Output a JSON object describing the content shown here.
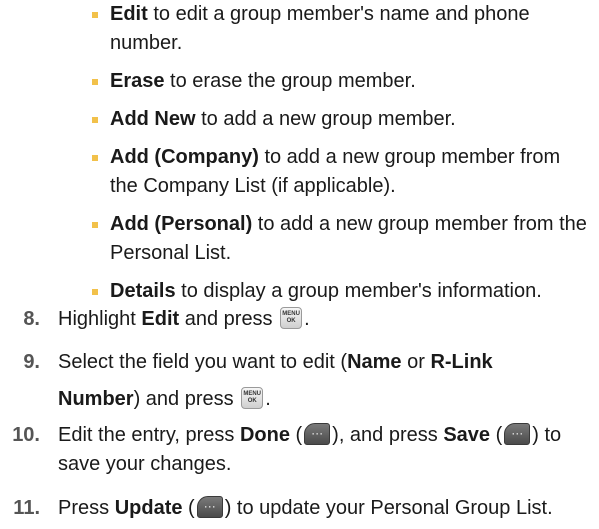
{
  "options": [
    {
      "term": "Edit",
      "text": " to edit a group member's name and phone number."
    },
    {
      "term": "Erase",
      "text": " to erase the group member."
    },
    {
      "term": "Add New",
      "text": " to add a new group member."
    },
    {
      "term": "Add (Company)",
      "text": " to add a new group member from the Company List (if applicable)."
    },
    {
      "term": "Add (Personal)",
      "text": " to add a new group member from the Personal List."
    },
    {
      "term": "Details",
      "text": " to display a group member's information."
    }
  ],
  "steps": {
    "s8": {
      "number": "8.",
      "t1": "Highlight ",
      "b1": "Edit",
      "t2": " and press "
    },
    "s9": {
      "number": "9.",
      "t1": "Select the field you want to edit (",
      "b1": "Name",
      "t2": " or ",
      "b2": "R-Link",
      "b3": "Number",
      "t3": ") and press "
    },
    "s10": {
      "number": "10.",
      "t1": "Edit the entry, press ",
      "b1": "Done",
      "t2": " (",
      "t3": "), and press ",
      "b2": "Save",
      "t4": " (",
      "t5": ") to",
      "t6": "save your changes."
    },
    "s11": {
      "number": "11.",
      "t1": "Press ",
      "b1": "Update",
      "t2": " (",
      "t3": ") to update your Personal Group List."
    }
  },
  "keys": {
    "menu_top": "MENU",
    "menu_bottom": "OK",
    "soft": "···"
  },
  "colors": {
    "bullet": "#f2c14a",
    "text": "#1a1a1a"
  }
}
